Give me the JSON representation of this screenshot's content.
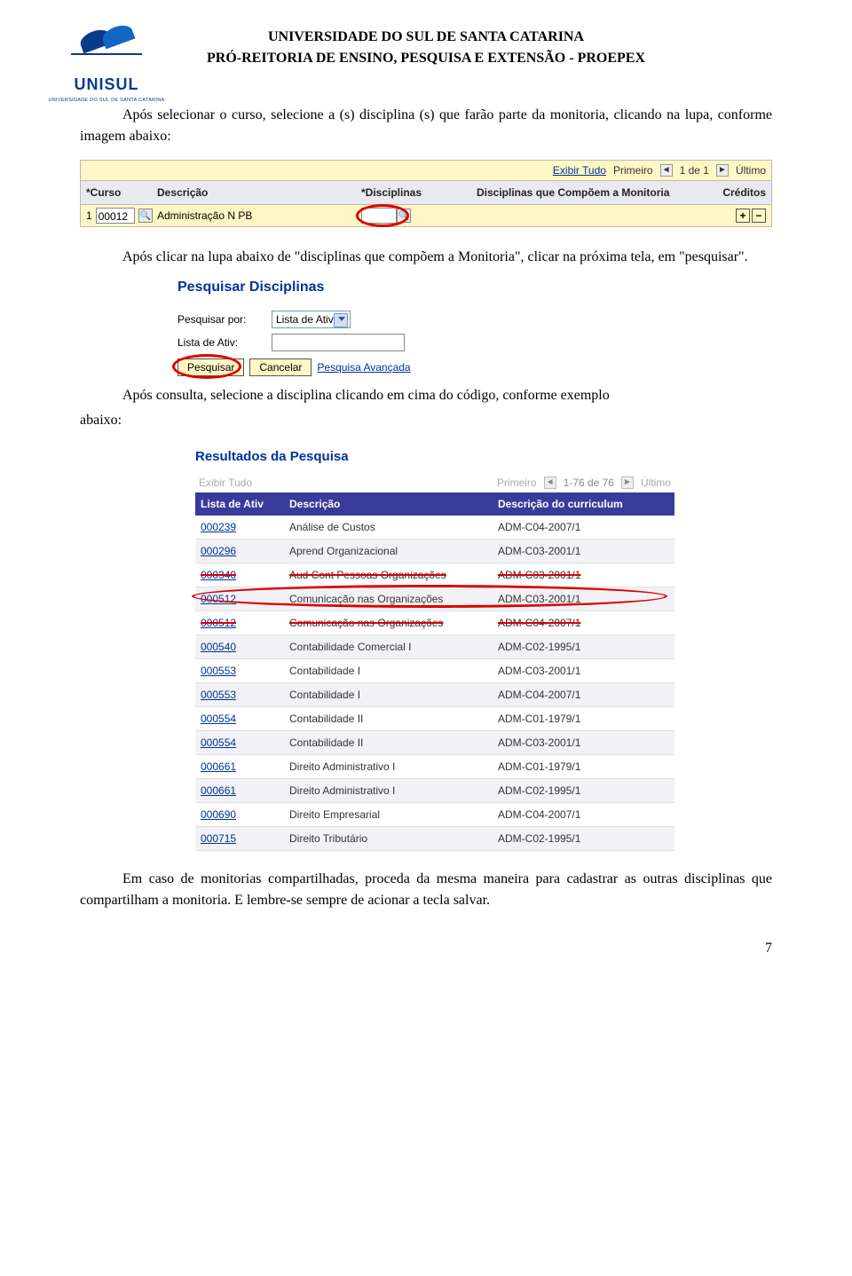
{
  "header": {
    "line1": "UNIVERSIDADE DO SUL DE SANTA CATARINA",
    "line2": "PRÓ-REITORIA DE ENSINO, PESQUISA E EXTENSÃO - PROEPEX",
    "logo_text": "UNISUL",
    "logo_sub": "UNIVERSIDADE DO SUL DE SANTA CATARINA"
  },
  "para1": "Após selecionar o curso, selecione a (s) disciplina (s) que farão parte da monitoria, clicando na lupa, conforme imagem abaixo:",
  "bar": {
    "exibir_tudo": "Exibir Tudo",
    "primeiro": "Primeiro",
    "count": "1 de 1",
    "ultimo": "Último",
    "cols": {
      "curso": "*Curso",
      "descricao": "Descrição",
      "disc1": "*Disciplinas",
      "disc2": "Disciplinas que Compõem a Monitoria",
      "creditos": "Créditos"
    },
    "row": {
      "n": "1",
      "curso_val": "00012",
      "desc_val": "Administração N PB"
    }
  },
  "para2": "Após clicar na lupa abaixo de \"disciplinas que compõem a Monitoria\", clicar na próxima tela, em \"pesquisar\".",
  "pesq": {
    "title": "Pesquisar Disciplinas",
    "pesquisar_por": "Pesquisar por:",
    "select_val": "Lista de Ativ",
    "lista_label": "Lista de Ativ:",
    "btn_pesquisar": "Pesquisar",
    "btn_cancelar": "Cancelar",
    "link_avancada": "Pesquisa Avançada"
  },
  "para3_pre": "Após consulta, selecione a disciplina clicando em cima do código, conforme exemplo",
  "para3_post": "abaixo:",
  "results": {
    "title": "Resultados da Pesquisa",
    "exibir_tudo": "Exibir Tudo",
    "primeiro": "Primeiro",
    "count": "1-76 de 76",
    "ultimo": "Último",
    "cols": {
      "c1": "Lista de Ativ",
      "c2": "Descrição",
      "c3": "Descrição do curriculum"
    },
    "rows": [
      {
        "c1": "000239",
        "c2": "Análise de Custos",
        "c3": "ADM-C04-2007/1"
      },
      {
        "c1": "000296",
        "c2": "Aprend Organizacional",
        "c3": "ADM-C03-2001/1"
      },
      {
        "c1": "000340",
        "c2": "Aud Cont Pessoas Organizações",
        "c3": "ADM-C03-2001/1",
        "strike": true
      },
      {
        "c1": "000512",
        "c2": "Comunicação nas Organizações",
        "c3": "ADM-C03-2001/1",
        "highlight": true
      },
      {
        "c1": "000512",
        "c2": "Comunicação nas Organizações",
        "c3": "ADM-C04-2007/1",
        "strike": true
      },
      {
        "c1": "000540",
        "c2": "Contabilidade Comercial I",
        "c3": "ADM-C02-1995/1"
      },
      {
        "c1": "000553",
        "c2": "Contabilidade I",
        "c3": "ADM-C03-2001/1"
      },
      {
        "c1": "000553",
        "c2": "Contabilidade I",
        "c3": "ADM-C04-2007/1"
      },
      {
        "c1": "000554",
        "c2": "Contabilidade II",
        "c3": "ADM-C01-1979/1"
      },
      {
        "c1": "000554",
        "c2": "Contabilidade II",
        "c3": "ADM-C03-2001/1"
      },
      {
        "c1": "000661",
        "c2": "Direito Administrativo I",
        "c3": "ADM-C01-1979/1"
      },
      {
        "c1": "000661",
        "c2": "Direito Administrativo I",
        "c3": "ADM-C02-1995/1"
      },
      {
        "c1": "000690",
        "c2": "Direito Empresarial",
        "c3": "ADM-C04-2007/1"
      },
      {
        "c1": "000715",
        "c2": "Direito Tributário",
        "c3": "ADM-C02-1995/1"
      }
    ]
  },
  "para4": "Em caso de monitorias compartilhadas, proceda da mesma maneira para cadastrar as outras disciplinas que compartilham a monitoria. E lembre-se sempre de acionar a tecla salvar.",
  "page_number": "7"
}
